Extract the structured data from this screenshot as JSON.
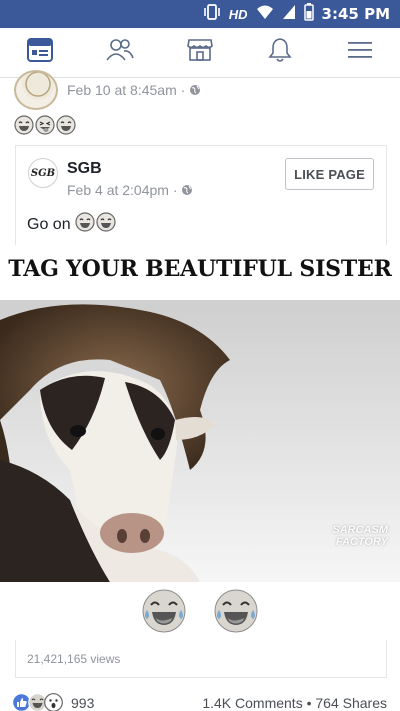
{
  "statusbar": {
    "hd": "HD",
    "time": "3:45 PM",
    "icons": [
      "vibrate-icon",
      "wifi-icon",
      "signal-icon",
      "battery-icon"
    ]
  },
  "nav": {
    "items": [
      {
        "name": "news-feed",
        "icon": "news-feed-icon",
        "active": true
      },
      {
        "name": "friends",
        "icon": "friends-icon",
        "active": false
      },
      {
        "name": "marketplace",
        "icon": "marketplace-icon",
        "active": false
      },
      {
        "name": "notifications",
        "icon": "bell-icon",
        "active": false
      },
      {
        "name": "menu",
        "icon": "hamburger-menu-icon",
        "active": false
      }
    ],
    "accent": "#3b5998"
  },
  "prev_post": {
    "date": "Feb 10 at 8:45am",
    "sep": "·",
    "emojis": [
      "laughing-face",
      "tongue-out-face",
      "laughing-face"
    ]
  },
  "shared_post": {
    "page_name": "SGB",
    "avatar_text": "SGB",
    "date": "Feb 4 at 2:04pm",
    "sep": "·",
    "like_page_label": "LIKE PAGE",
    "text": "Go on"
  },
  "meme": {
    "title": "TAG YOUR BEAUTIFUL SISTER",
    "watermark_line1": "SARCASM",
    "watermark_line2": "FACTORY"
  },
  "stats": {
    "views": "21,421,165 views",
    "reaction_count": "993",
    "comments_shares": "1.4K Comments • 764 Shares"
  }
}
